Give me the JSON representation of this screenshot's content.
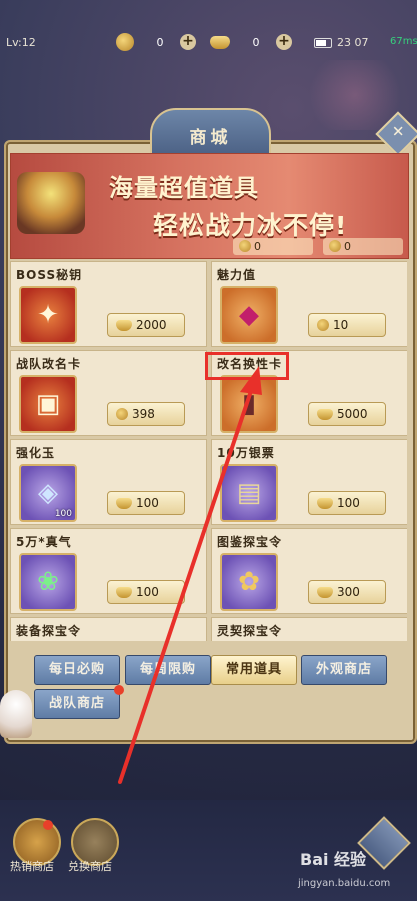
{
  "status": {
    "level": "Lv:12",
    "currency1_value": "0",
    "currency2_value": "0",
    "time": "23 07",
    "ms": "67ms"
  },
  "shop": {
    "title": "商城",
    "banner": {
      "line1": "海量超值道具",
      "line2": "轻松战力冰不停!",
      "count1": "0",
      "count2": "0"
    },
    "items": [
      {
        "name": "BOSS秘钥",
        "price": "2000",
        "currency": "ingot",
        "icon": "key-icon"
      },
      {
        "name": "魅力值",
        "price": "10",
        "currency": "coin",
        "icon": "gem-icon"
      },
      {
        "name": "战队改名卡",
        "price": "398",
        "currency": "coin",
        "icon": "team-card-icon"
      },
      {
        "name": "改名换性卡",
        "price": "5000",
        "currency": "ingot",
        "icon": "rename-card-icon"
      },
      {
        "name": "强化玉",
        "price": "100",
        "currency": "ingot",
        "icon": "jade-icon",
        "qty": "100"
      },
      {
        "name": "10万银票",
        "price": "100",
        "currency": "ingot",
        "icon": "banknote-icon"
      },
      {
        "name": "5万*真气",
        "price": "100",
        "currency": "ingot",
        "icon": "qi-icon"
      },
      {
        "name": "图鉴探宝令",
        "price": "300",
        "currency": "ingot",
        "icon": "token-icon"
      },
      {
        "name": "装备探宝令"
      },
      {
        "name": "灵契探宝令"
      }
    ],
    "tabs": [
      "每日必购",
      "每周限购",
      "常用道具",
      "外观商店",
      "战队商店"
    ],
    "active_tab": "常用道具"
  },
  "bottom": {
    "hot_shop": "热销商店",
    "exchange_shop": "兑换商店"
  },
  "watermark": {
    "brand": "Bai 经验",
    "url": "jingyan.baidu.com"
  },
  "colors": {
    "accent_red": "#e8302a",
    "panel": "#d9c9a6",
    "tab_blue": "#6f8db6",
    "tab_active": "#f3e2ae"
  }
}
